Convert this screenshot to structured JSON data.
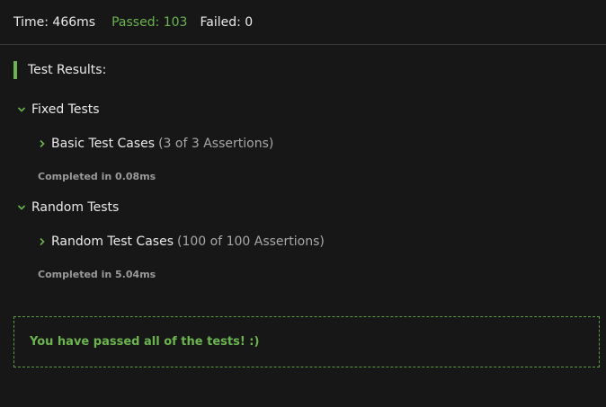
{
  "header": {
    "time": "Time: 466ms",
    "passed": "Passed: 103",
    "failed": "Failed: 0"
  },
  "results_title": "Test Results:",
  "groups": [
    {
      "label": "Fixed Tests",
      "case_label": "Basic Test Cases",
      "case_count": "(3 of 3 Assertions)",
      "completed": "Completed in 0.08ms"
    },
    {
      "label": "Random Tests",
      "case_label": "Random Test Cases",
      "case_count": "(100 of 100 Assertions)",
      "completed": "Completed in 5.04ms"
    }
  ],
  "pass_message": "You have passed all of the tests! :)",
  "colors": {
    "background": "#171717",
    "accent_green": "#6bb44f",
    "text": "#eaeaea",
    "muted": "#a8a8a8"
  }
}
